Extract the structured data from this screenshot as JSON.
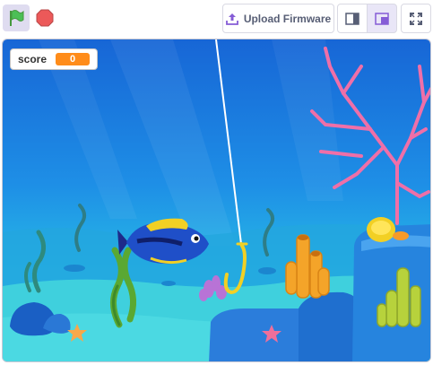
{
  "toolbar": {
    "green_flag_icon": "green-flag-icon",
    "stop_icon": "stop-sign-icon",
    "upload_label": "Upload Firmware",
    "upload_icon": "upload-icon",
    "layout_small_icon": "small-stage-icon",
    "layout_large_icon": "large-stage-icon",
    "fullscreen_icon": "fullscreen-icon"
  },
  "stage": {
    "monitor": {
      "label": "score",
      "value": "0"
    }
  },
  "colors": {
    "flag_green": "#4cbf56",
    "stop_red": "#ec5959",
    "monitor_orange": "#ff8c1a",
    "water_top": "#1a73d9",
    "sand": "#3fd0dd"
  }
}
